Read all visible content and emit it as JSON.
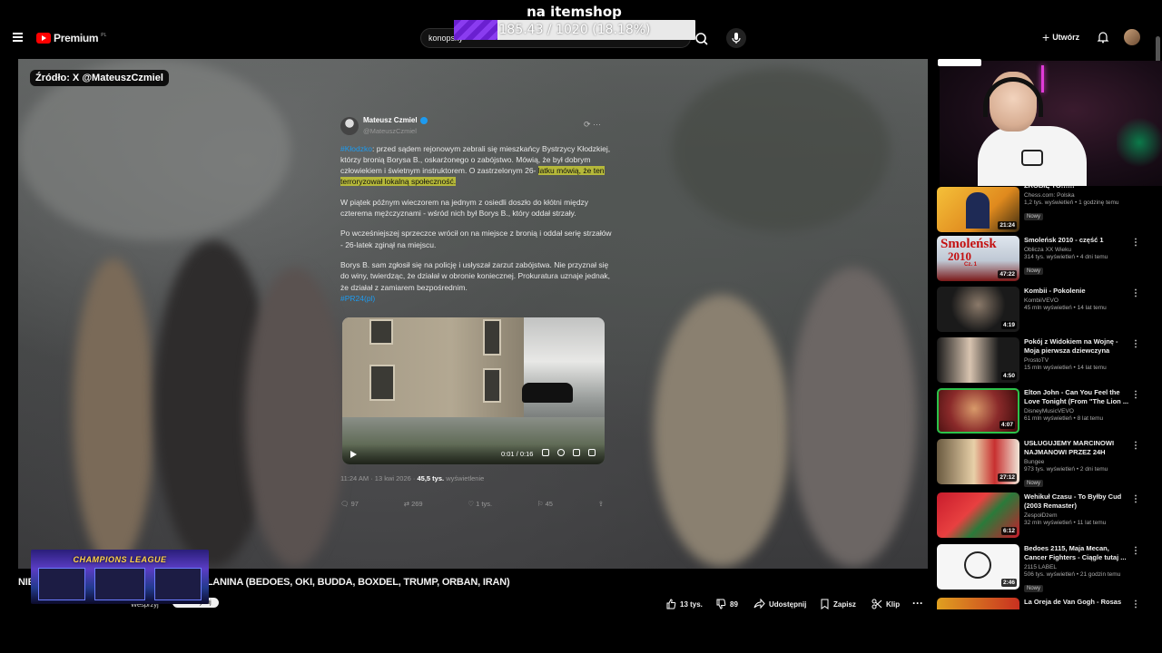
{
  "overlay": {
    "goal_title": "na itemshop",
    "goal_text": "185.43 / 1020 (18.18%)",
    "goal_progress": 0.1818
  },
  "header": {
    "logo_text": "Premium",
    "logo_country": "PL",
    "search_value": "konopsky",
    "create_label": "Utwórz"
  },
  "player": {
    "source_label": "Źródło: X @MateuszCzmiel",
    "tweet": {
      "author": "Mateusz Czmiel",
      "handle": "@MateuszCzmiel",
      "hashtag": "#Kłodzko",
      "p1_rest": ": przed sądem rejonowym zebrali się mieszkańcy Bystrzycy Kłodzkiej, którzy bronią Borysa B., oskarżonego o zabójstwo. Mówią, że był dobrym człowiekiem i świetnym instruktorem. O zastrzelonym 26-",
      "p1_highlight": "latku mówią, że ten terroryzował lokalną społeczność.",
      "p2": "W piątek późnym wieczorem na jednym z osiedli doszło do kłótni między czterema mężczyznami - wśród nich był Borys B., który oddał strzały.",
      "p3": "Po wcześniejszej sprzeczce wrócił on na miejsce z bronią i oddał serię strzałów - 26-latek zginął na miejscu.",
      "p4": "Borys B. sam zgłosił się na policję i usłyszał zarzut zabójstwa. Nie przyznał się do winy, twierdząc, że działał w obronie koniecznej. Prokuratura uznaje jednak, że działał z zamiarem bezpośrednim.",
      "source_tag": "#PR24(pl)",
      "video_time": "0:01 / 0:16",
      "meta_time": "11:24 AM · 13 kwi 2026 ·",
      "meta_views": "45,5 tys.",
      "meta_views_label": "wyświetlenie",
      "replies": "97",
      "reposts": "269",
      "likes": "1 tys.",
      "bookmarks": "45"
    }
  },
  "video": {
    "title_prefix": "NIE",
    "title_suffix": "LANINA (BEDOES, OKI, BUDDA, BOXDEL, TRUMP, ORBAN, IRAN)",
    "support_label": "Wesprzyj",
    "subscribe_label": "Subskrybuj",
    "champions_label": "CHAMPIONS LEAGUE",
    "likes": "13 tys.",
    "dislikes": "89",
    "share_label": "Udostępnij",
    "save_label": "Zapisz",
    "clip_label": "Klip"
  },
  "sidebar": {
    "items": [
      {
        "title": "ZROBIĘ TO!!!!!!",
        "channel": "Chess.com: Polska",
        "meta": "1,2 tys. wyświetleń • 1 godzinę temu",
        "badge": "Nowy",
        "duration": "21:24"
      },
      {
        "title": "Smoleńsk 2010 - część 1",
        "channel": "Oblicza XX Wieku",
        "meta": "314 tys. wyświetleń • 4 dni temu",
        "badge": "Nowy",
        "duration": "47:22",
        "thumb_title": "Smoleńsk",
        "thumb_year": "2010",
        "thumb_part": "Cz. 1"
      },
      {
        "title": "Kombii - Pokolenie",
        "channel": "KombiiVEVO",
        "meta": "45 mln wyświetleń • 14 lat temu",
        "badge": "",
        "duration": "4:19"
      },
      {
        "title": "Pokój z Widokiem na Wojnę - Moja pierwsza dziewczyna",
        "channel": "ProstoTV",
        "meta": "15 mln wyświetleń • 14 lat temu",
        "badge": "",
        "duration": "4:50"
      },
      {
        "title": "Elton John - Can You Feel the Love Tonight (From \"The Lion ...",
        "channel": "DisneyMusicVEVO",
        "meta": "61 mln wyświetleń • 8 lat temu",
        "badge": "",
        "duration": "4:07"
      },
      {
        "title": "USŁUGUJEMY MARCINOWI NAJMANOWI PRZEZ 24H",
        "channel": "Bungee",
        "meta": "973 tys. wyświetleń • 2 dni temu",
        "badge": "Nowy",
        "duration": "27:12"
      },
      {
        "title": "Wehikuł Czasu - To Byłby Cud (2003 Remaster)",
        "channel": "ZespołDżem",
        "meta": "32 mln wyświetleń • 11 lat temu",
        "badge": "",
        "duration": "6:12"
      },
      {
        "title": "Bedoes 2115, Maja Mecan, Cancer Fighters - Ciągle tutaj ...",
        "channel": "2115 LABEL",
        "meta": "506 tys. wyświetleń • 21 godzin temu",
        "badge": "Nowy",
        "duration": "2:46"
      },
      {
        "title": "La Oreja de Van Gogh - Rosas",
        "channel": "",
        "meta": "",
        "badge": "",
        "duration": ""
      }
    ]
  },
  "colors": {
    "brand_red": "#ff0000",
    "goal_purple": "#7a2ee0",
    "hashtag_blue": "#1d9bf0",
    "highlight": "#b5b83a"
  }
}
